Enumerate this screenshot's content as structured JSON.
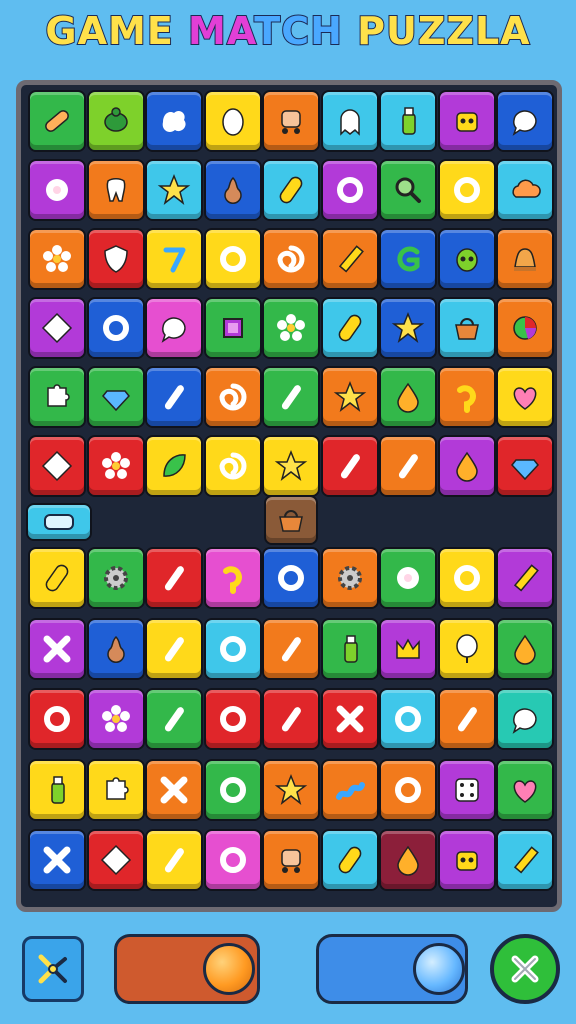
{
  "title": {
    "part1": "GAME ",
    "part2": "MA",
    "part3": "TCH ",
    "part4": "PUZZLA"
  },
  "colors": {
    "background": "#5fbdf0",
    "board": "#1d2638",
    "title_yellow": "#ffe14a",
    "title_pink": "#e23fd6",
    "title_blue": "#4aa8ff"
  },
  "grid": {
    "top_rows": [
      [
        [
          "green",
          "bandage-icon"
        ],
        [
          "lime",
          "turtle-icon"
        ],
        [
          "blue",
          "splash-icon"
        ],
        [
          "yellow",
          "egg-icon"
        ],
        [
          "orange",
          "stroller-icon"
        ],
        [
          "cyan",
          "ghost-icon"
        ],
        [
          "cyan",
          "bottle-icon"
        ],
        [
          "purple",
          "robot-icon"
        ],
        [
          "blue",
          "chat-bubble-icon"
        ]
      ],
      [
        [
          "purple",
          "donut-icon"
        ],
        [
          "orange",
          "tooth-icon"
        ],
        [
          "cyan",
          "star-icon"
        ],
        [
          "blue",
          "pear-icon"
        ],
        [
          "cyan",
          "pill-icon"
        ],
        [
          "purple",
          "ring-icon"
        ],
        [
          "green",
          "magnifier-icon"
        ],
        [
          "yellow",
          "ring-icon"
        ],
        [
          "cyan",
          "cloud-icon"
        ]
      ],
      [
        [
          "orange",
          "flower-icon"
        ],
        [
          "red",
          "shield-icon"
        ],
        [
          "yellow",
          "seven-icon"
        ],
        [
          "yellow",
          "ring-icon"
        ],
        [
          "orange",
          "swirl-icon"
        ],
        [
          "orange",
          "pencil-icon"
        ],
        [
          "blue",
          "letter-g-icon"
        ],
        [
          "blue",
          "alien-icon"
        ],
        [
          "orange",
          "bell-icon"
        ]
      ],
      [
        [
          "purple",
          "diamond-icon"
        ],
        [
          "blue",
          "ring-icon"
        ],
        [
          "pink",
          "chat-bubble-icon"
        ],
        [
          "green",
          "box-icon"
        ],
        [
          "green",
          "flower-icon"
        ],
        [
          "cyan",
          "pill-icon"
        ],
        [
          "blue",
          "star-icon"
        ],
        [
          "cyan",
          "basket-icon"
        ],
        [
          "orange",
          "pie-icon"
        ]
      ],
      [
        [
          "green",
          "puzzle-icon"
        ],
        [
          "green",
          "gem-icon"
        ],
        [
          "blue",
          "stick-icon"
        ],
        [
          "orange",
          "swirl-icon"
        ],
        [
          "green",
          "stick-icon"
        ],
        [
          "orange",
          "star-icon"
        ],
        [
          "green",
          "drop-icon"
        ],
        [
          "orange",
          "hook-icon"
        ],
        [
          "yellow",
          "heart-icon"
        ]
      ],
      [
        [
          "red",
          "diamond-icon"
        ],
        [
          "red",
          "flower-icon"
        ],
        [
          "yellow",
          "leaf-icon"
        ],
        [
          "yellow",
          "swirl-icon"
        ],
        [
          "yellow",
          "star-icon"
        ],
        [
          "red",
          "stick-icon"
        ],
        [
          "orange",
          "stick-icon"
        ],
        [
          "purple",
          "drop-icon"
        ],
        [
          "red",
          "gem-icon"
        ]
      ]
    ],
    "bottom_rows": [
      [
        [
          "yellow",
          "pill-icon"
        ],
        [
          "green",
          "gear-icon"
        ],
        [
          "red",
          "stick-icon"
        ],
        [
          "pink",
          "hook-icon"
        ],
        [
          "blue",
          "ring-icon"
        ],
        [
          "orange",
          "gear-icon"
        ],
        [
          "green",
          "donut-icon"
        ],
        [
          "yellow",
          "ring-icon"
        ],
        [
          "purple",
          "pencil-icon"
        ]
      ],
      [
        [
          "purple",
          "cross-icon"
        ],
        [
          "blue",
          "pear-icon"
        ],
        [
          "yellow",
          "stick-icon"
        ],
        [
          "cyan",
          "ring-icon"
        ],
        [
          "orange",
          "stick-icon"
        ],
        [
          "green",
          "bottle-icon"
        ],
        [
          "purple",
          "crown-icon"
        ],
        [
          "yellow",
          "balloon-icon"
        ],
        [
          "green",
          "drop-icon"
        ]
      ],
      [
        [
          "red",
          "ring-icon"
        ],
        [
          "purple",
          "flower-icon"
        ],
        [
          "green",
          "stick-icon"
        ],
        [
          "red",
          "ring-icon"
        ],
        [
          "red",
          "stick-icon"
        ],
        [
          "red",
          "cross-icon"
        ],
        [
          "cyan",
          "ring-icon"
        ],
        [
          "orange",
          "stick-icon"
        ],
        [
          "teal",
          "chat-bubble-icon"
        ]
      ],
      [
        [
          "yellow",
          "bottle-icon"
        ],
        [
          "yellow",
          "puzzle-icon"
        ],
        [
          "orange",
          "cross-icon"
        ],
        [
          "green",
          "ring-icon"
        ],
        [
          "orange",
          "star-icon"
        ],
        [
          "orange",
          "worm-icon"
        ],
        [
          "orange",
          "ring-icon"
        ],
        [
          "purple",
          "dice-icon"
        ],
        [
          "green",
          "heart-icon"
        ]
      ],
      [
        [
          "blue",
          "cross-icon"
        ],
        [
          "red",
          "diamond-icon"
        ],
        [
          "yellow",
          "stick-icon"
        ],
        [
          "pink",
          "ring-icon"
        ],
        [
          "orange",
          "stroller-icon"
        ],
        [
          "cyan",
          "pill-icon"
        ],
        [
          "maroon",
          "drop-icon"
        ],
        [
          "purple",
          "robot-icon"
        ],
        [
          "cyan",
          "pencil-icon"
        ]
      ]
    ],
    "gap_tiles": [
      {
        "color": "cyan",
        "icon": "tray-icon"
      },
      {
        "color": "brown",
        "icon": "basket-icon"
      }
    ]
  },
  "controls": {
    "left_button_icon": "bow-icon",
    "left_slider_color": "#cf5a2e",
    "left_knob_color": "#ff9a22",
    "right_slider_color": "#3e8de8",
    "right_knob_color": "#66b8ff",
    "close_icon": "close-icon"
  }
}
